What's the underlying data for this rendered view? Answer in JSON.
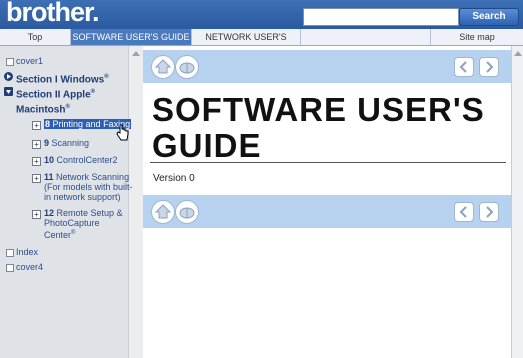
{
  "header": {
    "logo": "brother.",
    "search_value": "",
    "search_label": "Search"
  },
  "tabs": [
    {
      "label": "Top"
    },
    {
      "label": "SOFTWARE USER'S GUIDE"
    },
    {
      "label": "NETWORK USER'S GUIDE"
    },
    {
      "label": "Site map"
    }
  ],
  "sidebar": {
    "items": [
      {
        "label": "cover1"
      },
      {
        "label": "Section I Windows",
        "sup": "®"
      },
      {
        "label": "Section II Apple",
        "sup": "®",
        "label2": "Macintosh",
        "sup2": "®"
      },
      {
        "number": "8",
        "label": "Printing and Faxing"
      },
      {
        "number": "9",
        "label": "Scanning"
      },
      {
        "number": "10",
        "label": "ControlCenter2"
      },
      {
        "number": "11",
        "label": "Network Scanning",
        "label2": "(For models with built-",
        "label3": "in network support)"
      },
      {
        "number": "12",
        "label": "Remote Setup &",
        "label2": "PhotoCapture",
        "label3": "Center",
        "sup3": "®"
      },
      {
        "label": "Index"
      },
      {
        "label": "cover4"
      }
    ]
  },
  "main": {
    "title_line1": "SOFTWARE USER'S",
    "title_line2": "GUIDE",
    "version": "Version 0"
  },
  "colors": {
    "topbar": "#2b5aa0",
    "navband": "#b7d2ef",
    "sidebar": "#dfe3e8",
    "active_tab": "#4b79bd"
  }
}
